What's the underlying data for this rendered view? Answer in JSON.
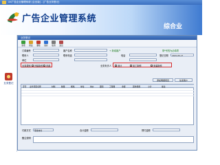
{
  "titlebar": {
    "text": "XX广告企业管理系统 [企业版] - [广告业务登记]"
  },
  "banner": {
    "title": "广告企业管理系统",
    "right_text": "综合业"
  },
  "leftnav": {
    "item_label": "业务登记"
  },
  "window": {
    "title": "业务登记"
  },
  "toolbar": {
    "items": [
      {
        "label": "新增",
        "color": "#3a9d3a"
      },
      {
        "label": "修改",
        "color": "#d8a128"
      },
      {
        "label": "删除",
        "color": "#c0392b"
      },
      {
        "label": "保存",
        "color": "#2d6fd1"
      },
      {
        "label": "取消",
        "color": "#7a7a7a"
      },
      {
        "label": "退出",
        "color": "#b34848"
      }
    ]
  },
  "form": {
    "order_no_label": "订单编号",
    "customer_label": "客户名称",
    "add_customer_link": "+ 新增客户",
    "hint_text": "带*号的为必填项",
    "contact_label": "联系人",
    "phone_label": "联系电话",
    "tel_label": "电话",
    "date_label": "登记日期",
    "date_value": "2015-05-17",
    "type_label": "业务类别",
    "type_option_1": "外接制作",
    "type_option_2": "内部",
    "company_label": "单位",
    "biz_label": "业务负责人",
    "checkbox_a_label": "设计",
    "checkbox_b_label": "加工制作",
    "checkbox_c_label": "安装制作",
    "btn_add_detail": "添加明细项目",
    "btn_customer_detail": "往来客户",
    "btn_delete": "删除"
  },
  "grid": {
    "headers": [
      "序号",
      "业务项目名称",
      "材料",
      "数量",
      "规格",
      "单位",
      "单价",
      "面积",
      "工程量",
      "金额",
      "其他费用",
      "小计",
      "备注"
    ]
  },
  "bottom": {
    "pay_label": "付款方式",
    "pay_value": "现金支付",
    "total_label": "合计金额",
    "deposit_label": "预付金额",
    "remark_label": "备注说明"
  }
}
